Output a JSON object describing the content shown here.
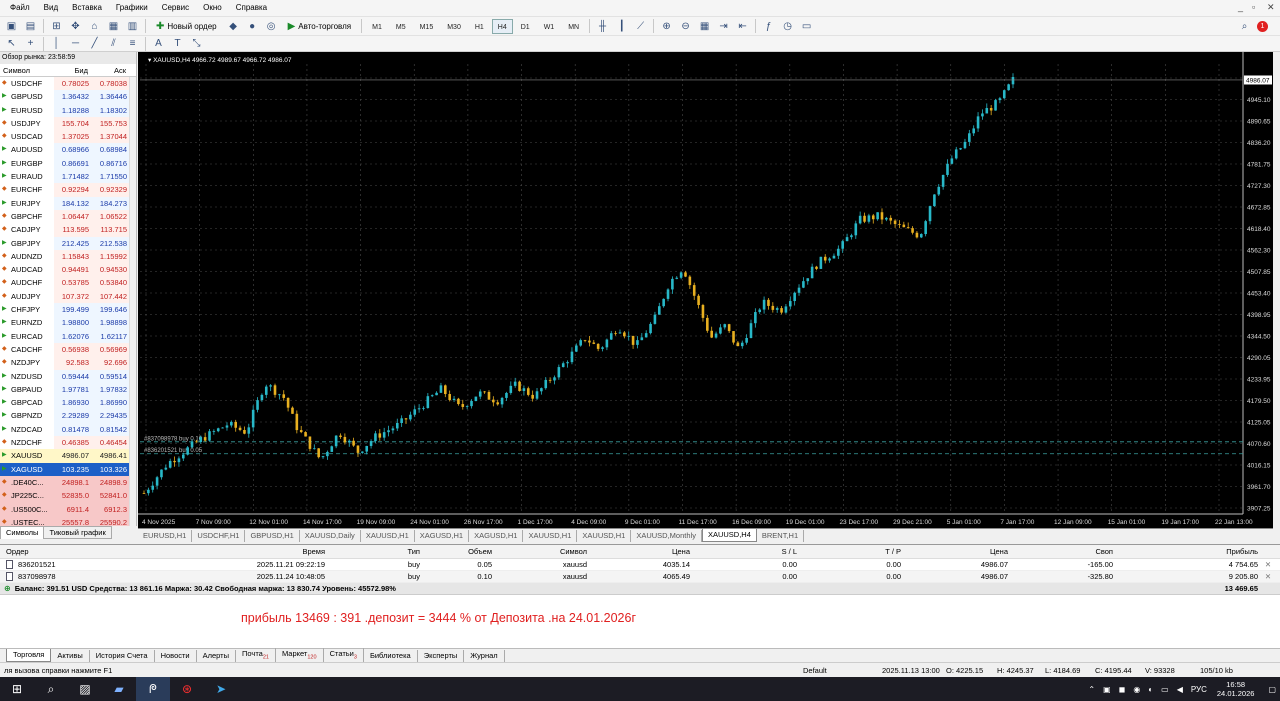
{
  "menu": [
    "Файл",
    "Вид",
    "Вставка",
    "Графики",
    "Сервис",
    "Окно",
    "Справка"
  ],
  "toolbar": {
    "new_order": "Новый ордер",
    "auto_trading": "Авто-торговля",
    "timeframes": [
      "M1",
      "M5",
      "M15",
      "M30",
      "H1",
      "H4",
      "D1",
      "W1",
      "MN"
    ],
    "active_timeframe": "H4"
  },
  "market_watch": {
    "title": "Обзор рынка: 23:58:59",
    "headers": {
      "symbol": "Символ",
      "bid": "Бид",
      "ask": "Аск"
    },
    "rows": [
      {
        "symbol": "USDCHF",
        "bid": "0.78025",
        "ask": "0.78038",
        "dir": "dn"
      },
      {
        "symbol": "GBPUSD",
        "bid": "1.36432",
        "ask": "1.36446",
        "dir": "up"
      },
      {
        "symbol": "EURUSD",
        "bid": "1.18288",
        "ask": "1.18302",
        "dir": "up"
      },
      {
        "symbol": "USDJPY",
        "bid": "155.704",
        "ask": "155.753",
        "dir": "dn"
      },
      {
        "symbol": "USDCAD",
        "bid": "1.37025",
        "ask": "1.37044",
        "dir": "dn"
      },
      {
        "symbol": "AUDUSD",
        "bid": "0.68966",
        "ask": "0.68984",
        "dir": "up"
      },
      {
        "symbol": "EURGBP",
        "bid": "0.86691",
        "ask": "0.86716",
        "dir": "up"
      },
      {
        "symbol": "EURAUD",
        "bid": "1.71482",
        "ask": "1.71550",
        "dir": "up"
      },
      {
        "symbol": "EURCHF",
        "bid": "0.92294",
        "ask": "0.92329",
        "dir": "dn"
      },
      {
        "symbol": "EURJPY",
        "bid": "184.132",
        "ask": "184.273",
        "dir": "up"
      },
      {
        "symbol": "GBPCHF",
        "bid": "1.06447",
        "ask": "1.06522",
        "dir": "dn"
      },
      {
        "symbol": "CADJPY",
        "bid": "113.595",
        "ask": "113.715",
        "dir": "dn"
      },
      {
        "symbol": "GBPJPY",
        "bid": "212.425",
        "ask": "212.538",
        "dir": "up"
      },
      {
        "symbol": "AUDNZD",
        "bid": "1.15843",
        "ask": "1.15992",
        "dir": "dn"
      },
      {
        "symbol": "AUDCAD",
        "bid": "0.94491",
        "ask": "0.94530",
        "dir": "dn"
      },
      {
        "symbol": "AUDCHF",
        "bid": "0.53785",
        "ask": "0.53840",
        "dir": "dn"
      },
      {
        "symbol": "AUDJPY",
        "bid": "107.372",
        "ask": "107.442",
        "dir": "dn"
      },
      {
        "symbol": "CHFJPY",
        "bid": "199.499",
        "ask": "199.646",
        "dir": "up"
      },
      {
        "symbol": "EURNZD",
        "bid": "1.98800",
        "ask": "1.98898",
        "dir": "up"
      },
      {
        "symbol": "EURCAD",
        "bid": "1.62076",
        "ask": "1.62117",
        "dir": "up"
      },
      {
        "symbol": "CADCHF",
        "bid": "0.56938",
        "ask": "0.56969",
        "dir": "dn"
      },
      {
        "symbol": "NZDJPY",
        "bid": "92.583",
        "ask": "92.696",
        "dir": "dn"
      },
      {
        "symbol": "NZDUSD",
        "bid": "0.59444",
        "ask": "0.59514",
        "dir": "up"
      },
      {
        "symbol": "GBPAUD",
        "bid": "1.97781",
        "ask": "1.97832",
        "dir": "up"
      },
      {
        "symbol": "GBPCAD",
        "bid": "1.86930",
        "ask": "1.86990",
        "dir": "up"
      },
      {
        "symbol": "GBPNZD",
        "bid": "2.29289",
        "ask": "2.29435",
        "dir": "up"
      },
      {
        "symbol": "NZDCAD",
        "bid": "0.81478",
        "ask": "0.81542",
        "dir": "up"
      },
      {
        "symbol": "NZDCHF",
        "bid": "0.46385",
        "ask": "0.46454",
        "dir": "dn"
      },
      {
        "symbol": "XAUUSD",
        "bid": "4986.07",
        "ask": "4986.41",
        "dir": "up",
        "state": "hl"
      },
      {
        "symbol": "XAGUSD",
        "bid": "103.235",
        "ask": "103.326",
        "dir": "up",
        "state": "sel"
      },
      {
        "symbol": ".DE40C...",
        "bid": "24898.1",
        "ask": "24898.9",
        "dir": "dn",
        "state": "pink"
      },
      {
        "symbol": "JP225C...",
        "bid": "52835.0",
        "ask": "52841.0",
        "dir": "dn",
        "state": "pink"
      },
      {
        "symbol": ".US500C...",
        "bid": "6911.4",
        "ask": "6912.3",
        "dir": "dn",
        "state": "pink"
      },
      {
        "symbol": ".USTEC...",
        "bid": "25557.8",
        "ask": "25590.2",
        "dir": "dn",
        "state": "pink"
      }
    ],
    "tabs": [
      "Символы",
      "Тиковый график"
    ]
  },
  "chart_data": {
    "type": "candlestick",
    "symbol_header": "XAUUSD,H4  4966.72 4989.67 4966.72 4986.07",
    "y_ticks": [
      "5001.30",
      "4945.10",
      "4890.65",
      "4836.20",
      "4781.75",
      "4727.30",
      "4672.85",
      "4618.40",
      "4562.30",
      "4507.85",
      "4453.40",
      "4398.95",
      "4344.50",
      "4290.05",
      "4233.95",
      "4179.50",
      "4125.05",
      "4070.60",
      "4016.15",
      "3961.70",
      "3907.25"
    ],
    "current_price": "4986.07",
    "x_ticks": [
      "4 Nov 2025",
      "7 Nov 09:00",
      "12 Nov 01:00",
      "14 Nov 17:00",
      "19 Nov 09:00",
      "24 Nov 01:00",
      "26 Nov 17:00",
      "1 Dec 17:00",
      "4 Dec 09:00",
      "9 Dec 01:00",
      "11 Dec 17:00",
      "16 Dec 09:00",
      "19 Dec 01:00",
      "23 Dec 17:00",
      "29 Dec 21:00",
      "5 Jan 01:00",
      "7 Jan 17:00",
      "12 Jan 09:00",
      "15 Jan 01:00",
      "19 Jan 17:00",
      "22 Jan 13:00"
    ],
    "order_lines": [
      {
        "label": "#837098978 buy 0.10",
        "price": 4065.49
      },
      {
        "label": "#836201521 buy 0.05",
        "price": 4035.14
      }
    ],
    "ylim": [
      3907.25,
      5001.3
    ],
    "close_path": [
      [
        0,
        3935
      ],
      [
        5,
        4010
      ],
      [
        12,
        4070
      ],
      [
        18,
        4110
      ],
      [
        22,
        4090
      ],
      [
        26,
        4215
      ],
      [
        30,
        4180
      ],
      [
        33,
        4100
      ],
      [
        38,
        4020
      ],
      [
        42,
        4090
      ],
      [
        46,
        4040
      ],
      [
        50,
        4080
      ],
      [
        55,
        4110
      ],
      [
        60,
        4160
      ],
      [
        64,
        4200
      ],
      [
        68,
        4150
      ],
      [
        72,
        4190
      ],
      [
        76,
        4170
      ],
      [
        80,
        4210
      ],
      [
        84,
        4180
      ],
      [
        90,
        4260
      ],
      [
        95,
        4330
      ],
      [
        98,
        4300
      ],
      [
        102,
        4360
      ],
      [
        106,
        4310
      ],
      [
        110,
        4380
      ],
      [
        113,
        4470
      ],
      [
        116,
        4510
      ],
      [
        119,
        4420
      ],
      [
        122,
        4330
      ],
      [
        125,
        4360
      ],
      [
        128,
        4300
      ],
      [
        133,
        4420
      ],
      [
        137,
        4400
      ],
      [
        140,
        4450
      ],
      [
        145,
        4520
      ],
      [
        150,
        4560
      ],
      [
        154,
        4630
      ],
      [
        158,
        4640
      ],
      [
        163,
        4610
      ],
      [
        167,
        4590
      ],
      [
        170,
        4700
      ],
      [
        174,
        4790
      ],
      [
        177,
        4830
      ],
      [
        180,
        4900
      ],
      [
        184,
        4930
      ],
      [
        187,
        4986
      ]
    ]
  },
  "chart_tabs": [
    "EURUSD,H1",
    "USDCHF,H1",
    "GBPUSD,H1",
    "XAUUSD,Daily",
    "XAUUSD,H1",
    "XAGUSD,H1",
    "XAGUSD,H1",
    "XAUUSD,H1",
    "XAUUSD,H1",
    "XAUUSD,Monthly",
    "XAUUSD,H4",
    "BRENT,H1"
  ],
  "active_chart_tab": "XAUUSD,H4",
  "terminal": {
    "headers": {
      "order": "Ордер",
      "time": "Время",
      "type": "Тип",
      "volume": "Объем",
      "symbol": "Символ",
      "price": "Цена",
      "sl": "S / L",
      "tp": "T / P",
      "cur_price": "Цена",
      "swap": "Своп",
      "profit": "Прибыль"
    },
    "rows": [
      {
        "order": "836201521",
        "time": "2025.11.21 09:22:19",
        "type": "buy",
        "volume": "0.05",
        "symbol": "xauusd",
        "price": "4035.14",
        "sl": "0.00",
        "tp": "0.00",
        "cur_price": "4986.07",
        "swap": "-165.00",
        "profit": "4 754.65"
      },
      {
        "order": "837098978",
        "time": "2025.11.24 10:48:05",
        "type": "buy",
        "volume": "0.10",
        "symbol": "xauusd",
        "price": "4065.49",
        "sl": "0.00",
        "tp": "0.00",
        "cur_price": "4986.07",
        "swap": "-325.80",
        "profit": "9 205.80"
      }
    ],
    "balance_text": "Баланс: 391.51 USD  Средства: 13 861.16  Маржа: 30.42  Свободная маржа: 13 830.74  Уровень: 45572.98%",
    "total_profit": "13 469.65",
    "note": "прибыль  13469 : 391 .депозит = 3444  % от Депозита .на 24.01.2026г",
    "tabs": [
      {
        "label": "Торговля",
        "badge": ""
      },
      {
        "label": "Активы",
        "badge": ""
      },
      {
        "label": "История Счета",
        "badge": ""
      },
      {
        "label": "Новости",
        "badge": ""
      },
      {
        "label": "Алерты",
        "badge": ""
      },
      {
        "label": "Почта",
        "badge": "21"
      },
      {
        "label": "Маркет",
        "badge": "120"
      },
      {
        "label": "Статьи",
        "badge": "3"
      },
      {
        "label": "Библиотека",
        "badge": ""
      },
      {
        "label": "Эксперты",
        "badge": ""
      },
      {
        "label": "Журнал",
        "badge": ""
      }
    ]
  },
  "status": {
    "help": "ля вызова справки нажмите F1",
    "profile": "Default",
    "datetime": "2025.11.13 13:00",
    "open": "O: 4225.15",
    "high": "H: 4245.37",
    "low": "L: 4184.69",
    "close": "C: 4195.44",
    "volume": "V: 93328",
    "traffic": "105/10 kb"
  },
  "taskbar": {
    "lang": "РУС",
    "time": "16:58",
    "date": "24.01.2026"
  }
}
